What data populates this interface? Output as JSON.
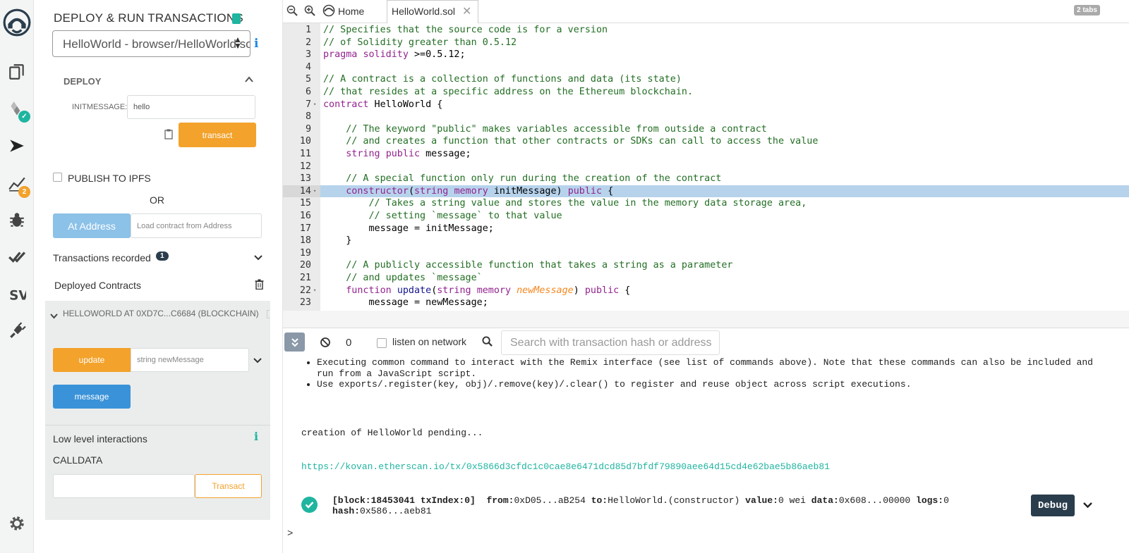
{
  "rail": {
    "items": [
      {
        "icon": "remix-logo-icon"
      },
      {
        "icon": "file-explorer-icon"
      },
      {
        "icon": "solidity-compiler-icon",
        "badge": "✓"
      },
      {
        "icon": "deploy-run-icon"
      },
      {
        "icon": "analysis-icon",
        "badge": "2"
      },
      {
        "icon": "debugger-icon"
      },
      {
        "icon": "unit-testing-icon"
      },
      {
        "icon": "sourcify-icon"
      },
      {
        "icon": "plugin-manager-icon"
      },
      {
        "icon": "settings-icon"
      }
    ],
    "compiler_badge": "✓",
    "analysis_badge": "2"
  },
  "panel": {
    "title": "DEPLOY & RUN TRANSACTIONS",
    "contract_select": "HelloWorld - browser/HelloWorld.sol",
    "info_glyph": "i",
    "deploy": {
      "header": "DEPLOY",
      "initmessage_label": "INITMESSAGE:",
      "initmessage_value": "hello",
      "transact_label": "transact"
    },
    "publish_ipfs": "PUBLISH TO IPFS",
    "or": "OR",
    "at_address_label": "At Address",
    "at_address_placeholder": "Load contract from Address",
    "transactions_recorded": "Transactions recorded",
    "transactions_count": "1",
    "deployed_contracts": "Deployed Contracts",
    "instance": {
      "title": "HELLOWORLD AT 0XD7C...C6684 (BLOCKCHAIN)",
      "update_label": "update",
      "update_placeholder": "string newMessage",
      "message_label": "message"
    },
    "low_level": {
      "title": "Low level interactions",
      "info_glyph": "i",
      "calldata_label": "CALLDATA",
      "transact_label": "Transact"
    }
  },
  "tabs": {
    "home_label": "Home",
    "file_tab": "HelloWorld.sol",
    "tab_count": "2 tabs"
  },
  "editor": {
    "highlighted_line": 14,
    "lines": [
      {
        "n": "1",
        "fold": "",
        "html": "<span class=\"cm\">// Specifies that the source code is for a version</span>"
      },
      {
        "n": "2",
        "fold": "",
        "html": "<span class=\"cm\">// of Solidity greater than 0.5.12</span>"
      },
      {
        "n": "3",
        "fold": "",
        "html": "<span class=\"kw\">pragma</span> <span class=\"kw\">solidity</span> &gt;=0.5.12;"
      },
      {
        "n": "4",
        "fold": "",
        "html": ""
      },
      {
        "n": "5",
        "fold": "",
        "html": "<span class=\"cm\">// A contract is a collection of functions and data (its state)</span>"
      },
      {
        "n": "6",
        "fold": "",
        "html": "<span class=\"cm\">// that resides at a specific address on the Ethereum blockchain.</span>"
      },
      {
        "n": "7",
        "fold": "▾",
        "html": "<span class=\"kw\">contract</span> HelloWorld {"
      },
      {
        "n": "8",
        "fold": "",
        "html": ""
      },
      {
        "n": "9",
        "fold": "",
        "html": "    <span class=\"cm\">// The keyword \"public\" makes variables accessible from outside a contract</span>"
      },
      {
        "n": "10",
        "fold": "",
        "html": "    <span class=\"cm\">// and creates a function that other contracts or SDKs can call to access the value</span>"
      },
      {
        "n": "11",
        "fold": "",
        "html": "    <span class=\"kw\">string</span> <span class=\"kw\">public</span> message;"
      },
      {
        "n": "12",
        "fold": "",
        "html": ""
      },
      {
        "n": "13",
        "fold": "",
        "html": "    <span class=\"cm\">// A special function only run during the creation of the contract</span>"
      },
      {
        "n": "14",
        "fold": "▾",
        "html": "    <span class=\"kw\">constructor</span>(<span class=\"kw\">string</span> <span class=\"kw\">memory</span> initMessage) <span class=\"kw\">public</span> {"
      },
      {
        "n": "15",
        "fold": "",
        "html": "        <span class=\"cm\">// Takes a string value and stores the value in the memory data storage area,</span>"
      },
      {
        "n": "16",
        "fold": "",
        "html": "        <span class=\"cm\">// setting `message` to that value</span>"
      },
      {
        "n": "17",
        "fold": "",
        "html": "        message = initMessage;"
      },
      {
        "n": "18",
        "fold": "",
        "html": "    }"
      },
      {
        "n": "19",
        "fold": "",
        "html": ""
      },
      {
        "n": "20",
        "fold": "",
        "html": "    <span class=\"cm\">// A publicly accessible function that takes a string as a parameter</span>"
      },
      {
        "n": "21",
        "fold": "",
        "html": "    <span class=\"cm\">// and updates `message`</span>"
      },
      {
        "n": "22",
        "fold": "▾",
        "html": "    <span class=\"kw\">function</span> <span class=\"fn\">update</span>(<span class=\"kw\">string</span> <span class=\"kw\">memory</span> <span class=\"pm\">newMessage</span>) <span class=\"kw\">public</span> {"
      },
      {
        "n": "23",
        "fold": "",
        "html": "        message = newMessage;"
      }
    ]
  },
  "terminal": {
    "pending_count": "0",
    "listen_label": "listen on network",
    "search_placeholder": "Search with transaction hash or address",
    "bullet1": "Executing common command to interact with the Remix interface (see list of commands above). Note that these commands can also be included and run from a JavaScript script.",
    "bullet2": "Use exports/.register(key, obj)/.remove(key)/.clear() to register and reuse object across script executions.",
    "pending_text": "creation of HelloWorld pending...",
    "etherscan_link": "https://kovan.etherscan.io/tx/0x5866d3cfdc1c0cae8e6471dcd85d7bfdf79890aee64d15cd4e62bae5b86aeb81",
    "tx_block_bracket": "[block:18453041 txIndex:0]",
    "tx_from_key": "from:",
    "tx_from_val": "0xD05...aB254",
    "tx_to_key": "to:",
    "tx_to_val": "HelloWorld.(constructor)",
    "tx_value_key": "value:",
    "tx_value_val": "0 wei",
    "tx_data_key": "data:",
    "tx_data_val": "0x608...00000",
    "tx_logs_key": "logs:",
    "tx_logs_val": "0",
    "tx_hash_key": "hash:",
    "tx_hash_val": "0x586...aeb81",
    "debug_label": "Debug",
    "prompt": ">"
  },
  "colors": {
    "orange": "#f3a22b",
    "blue": "#3a92d8",
    "light_blue": "#8cc1e8",
    "teal": "#1fb5a0",
    "highlight": "#b7d3ec",
    "comment": "#236e24",
    "keyword": "#93238f"
  }
}
